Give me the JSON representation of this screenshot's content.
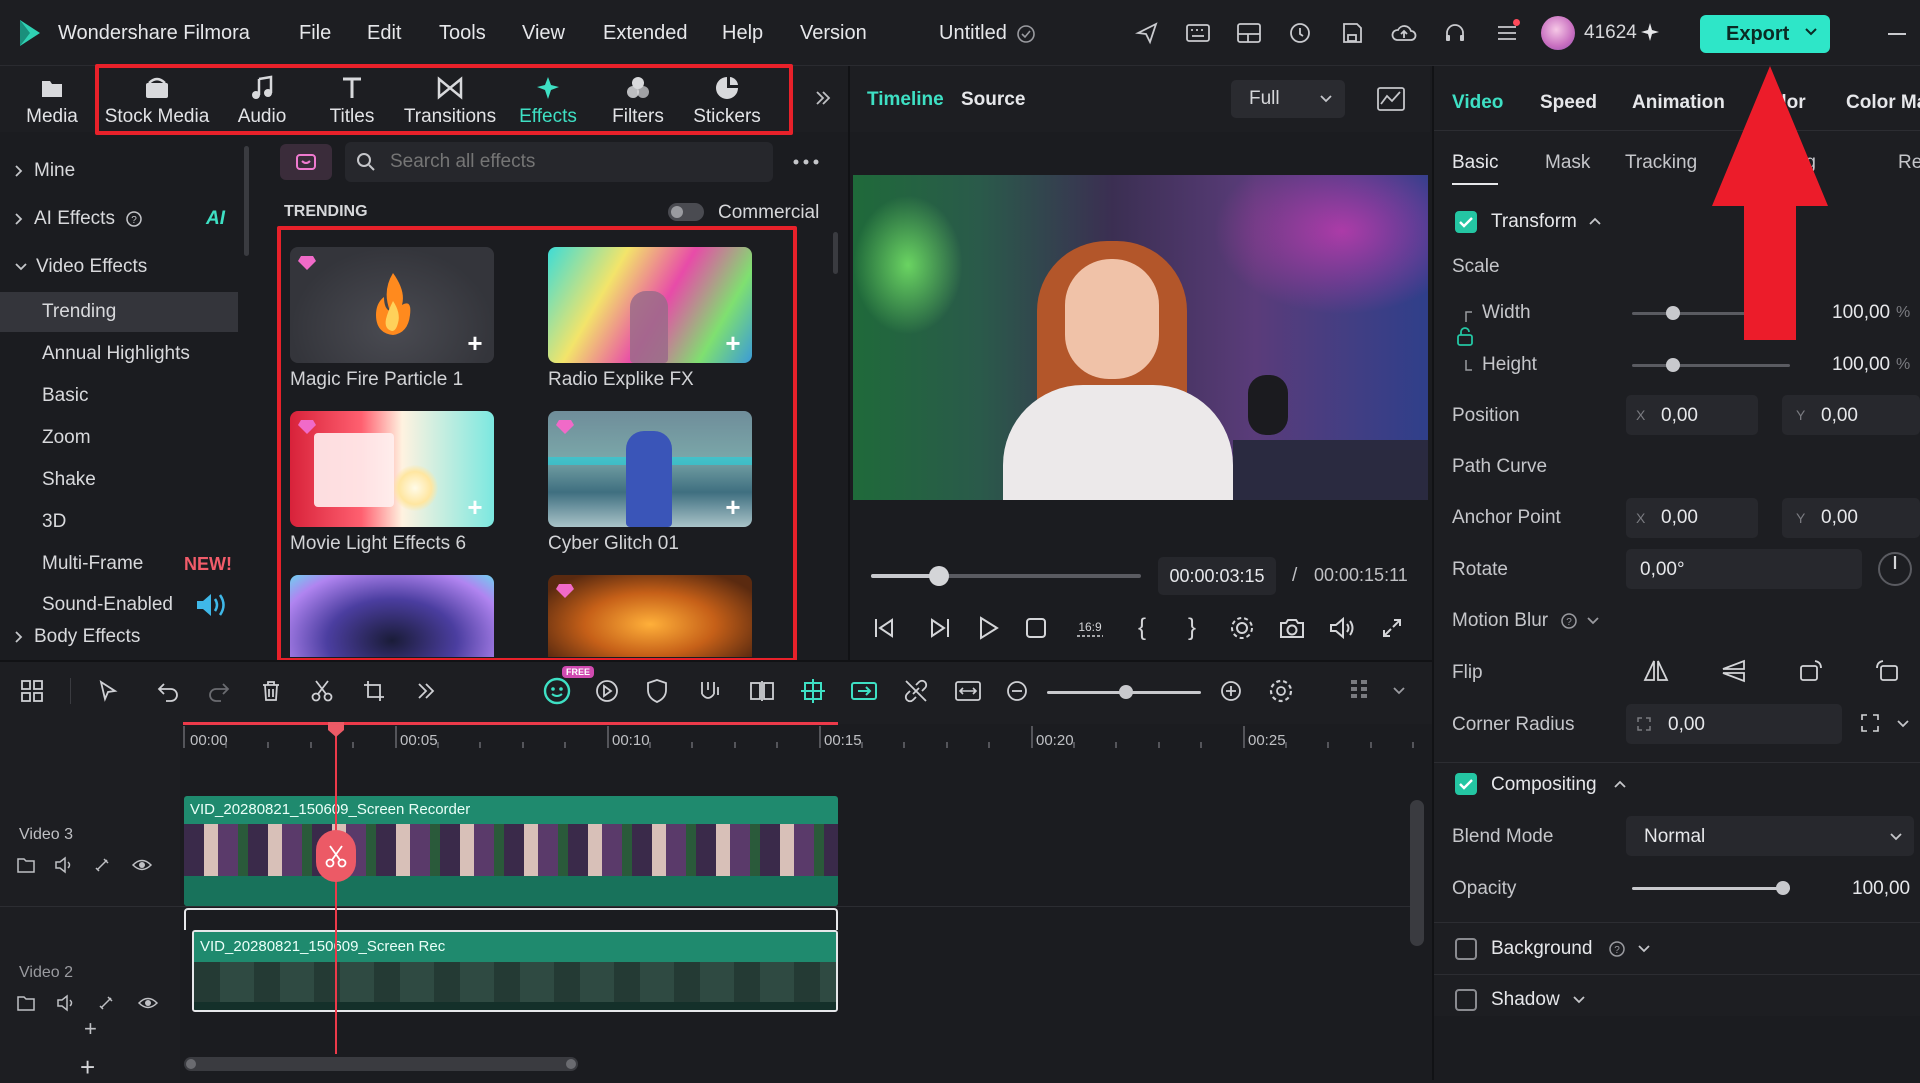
{
  "app": {
    "name": "Wondershare Filmora",
    "project_title": "Untitled",
    "credits": "41624",
    "export_label": "Export"
  },
  "menu": [
    "File",
    "Edit",
    "Tools",
    "View",
    "Extended",
    "Help",
    "Version"
  ],
  "toolbar": [
    "Media",
    "Stock Media",
    "Audio",
    "Titles",
    "Transitions",
    "Effects",
    "Filters",
    "Stickers"
  ],
  "left_nav": {
    "mine": "Mine",
    "ai_effects": "AI Effects",
    "ai_badge": "AI",
    "video_effects": "Video Effects",
    "items": [
      "Trending",
      "Annual Highlights",
      "Basic",
      "Zoom",
      "Shake",
      "3D",
      "Multi-Frame",
      "Sound-Enabled"
    ],
    "new_badge": "NEW!",
    "body_effects": "Body Effects"
  },
  "effects": {
    "search_placeholder": "Search all effects",
    "section": "TRENDING",
    "commercial_label": "Commercial",
    "cards": [
      "Magic Fire Particle 1",
      "Radio Explike FX",
      "Movie Light Effects 6",
      "Cyber Glitch 01"
    ]
  },
  "preview": {
    "tabs": [
      "Timeline",
      "Source"
    ],
    "zoom": "Full",
    "current_time": "00:00:03:15",
    "separator": "/",
    "total_time": "00:00:15:11",
    "progress": 0.25
  },
  "timeline": {
    "ruler": [
      "00:00",
      "00:05",
      "00:10",
      "00:15",
      "00:20",
      "00:25"
    ],
    "tracks": [
      {
        "label": "Video 3",
        "clip": "VID_20280821_150609_Screen Recorder"
      },
      {
        "label": "Video 2",
        "clip": "VID_20280821_150609_Screen Rec"
      }
    ],
    "free_badge": "FREE"
  },
  "properties": {
    "tabs": [
      "Video",
      "Speed",
      "Animation",
      "Color",
      "Color Ma"
    ],
    "subtabs": [
      "Basic",
      "Mask",
      "Tracking",
      "tting",
      "Re"
    ],
    "transform": "Transform",
    "scale": "Scale",
    "width_label": "Width",
    "width_value": "100,00",
    "pct": "%",
    "height_label": "Height",
    "height_value": "100,00",
    "position": "Position",
    "pos_x": "0,00",
    "pos_y": "0,00",
    "x_axis": "X",
    "y_axis": "Y",
    "path_curve": "Path Curve",
    "anchor_point": "Anchor Point",
    "anchor_x": "0,00",
    "anchor_y": "0,00",
    "rotate": "Rotate",
    "rotate_value": "0,00°",
    "motion_blur": "Motion Blur",
    "flip": "Flip",
    "corner_radius": "Corner Radius",
    "corner_value": "0,00",
    "compositing": "Compositing",
    "blend_mode": "Blend Mode",
    "blend_value": "Normal",
    "opacity": "Opacity",
    "opacity_value": "100,00",
    "background": "Background",
    "shadow": "Shadow"
  },
  "colors": {
    "accent": "#24c6a3",
    "highlight": "#e8212a",
    "track": "#1f8a6e"
  }
}
